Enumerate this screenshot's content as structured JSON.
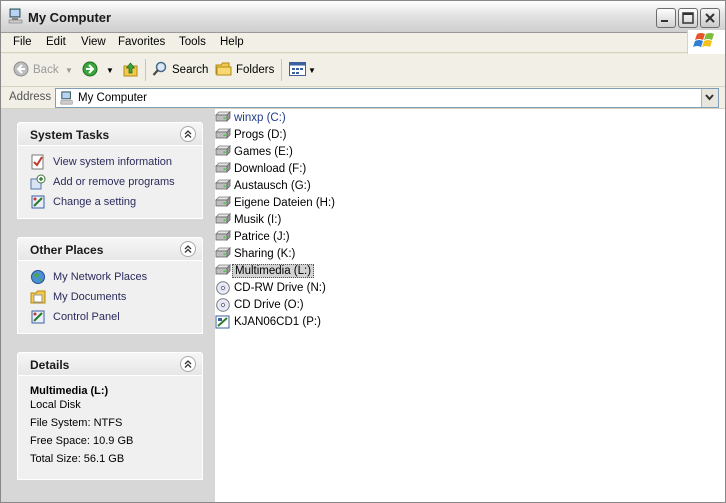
{
  "window": {
    "title": "My Computer"
  },
  "menu": [
    "File",
    "Edit",
    "View",
    "Favorites",
    "Tools",
    "Help"
  ],
  "toolbar": {
    "back": "Back",
    "search": "Search",
    "folders": "Folders"
  },
  "address": {
    "label": "Address",
    "value": "My Computer"
  },
  "system_tasks": {
    "title": "System Tasks",
    "items": [
      "View system information",
      "Add or remove programs",
      "Change a setting"
    ]
  },
  "other_places": {
    "title": "Other Places",
    "items": [
      "My Network Places",
      "My Documents",
      "Control Panel"
    ]
  },
  "details": {
    "title": "Details",
    "name": "Multimedia (L:)",
    "type": "Local Disk",
    "filesystem": "File System: NTFS",
    "free": "Free Space: 10.9 GB",
    "total": "Total Size: 56.1 GB"
  },
  "drives": [
    {
      "label": "winxp (C:)",
      "icon": "hard-drive-icon"
    },
    {
      "label": "Progs (D:)",
      "icon": "hard-drive-icon"
    },
    {
      "label": "Games (E:)",
      "icon": "hard-drive-icon"
    },
    {
      "label": "Download (F:)",
      "icon": "hard-drive-icon"
    },
    {
      "label": "Austausch (G:)",
      "icon": "hard-drive-icon"
    },
    {
      "label": "Eigene Dateien (H:)",
      "icon": "hard-drive-icon"
    },
    {
      "label": "Musik (I:)",
      "icon": "hard-drive-icon"
    },
    {
      "label": "Patrice (J:)",
      "icon": "hard-drive-icon"
    },
    {
      "label": "Sharing (K:)",
      "icon": "hard-drive-icon"
    },
    {
      "label": "Multimedia (L:)",
      "icon": "hard-drive-icon",
      "selected": true
    },
    {
      "label": "CD-RW Drive (N:)",
      "icon": "cd-drive-icon"
    },
    {
      "label": "CD Drive (O:)",
      "icon": "cd-drive-icon"
    },
    {
      "label": "KJAN06CD1 (P:)",
      "icon": "network-drive-icon"
    }
  ]
}
